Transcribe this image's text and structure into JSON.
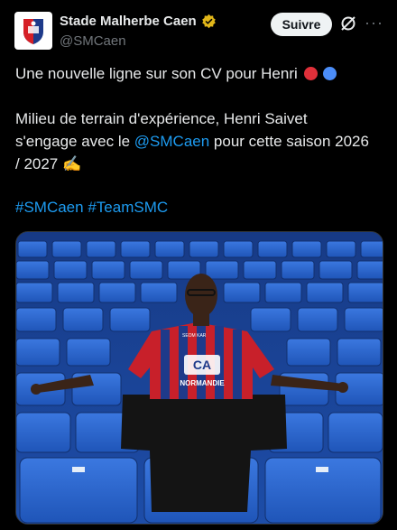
{
  "account": {
    "display_name": "Stade Malherbe Caen",
    "handle": "@SMCaen",
    "verified_badge_color": "#e2b719"
  },
  "actions": {
    "follow_label": "Suivre",
    "grok_icon": "grok-icon",
    "more_icon": "more-icon"
  },
  "tweet": {
    "line1": "Une nouvelle ligne sur son CV pour Henri",
    "line1_emoji": [
      "red-circle",
      "blue-circle"
    ],
    "para2_a": "Milieu de terrain d'expérience, Henri Saivet",
    "para2_b_pre": "s'engage avec le ",
    "para2_b_mention": "@SMCaen",
    "para2_b_post": " pour cette saison 2026",
    "para2_c": "/ 2027 ✍️",
    "hashtag1": "#SMCaen",
    "hashtag2": "#TeamSMC"
  },
  "media": {
    "jersey_sponsor": "CA",
    "jersey_brand": "NORMANDIE",
    "jersey_chest_text": "SEOM KAR"
  },
  "colors": {
    "background": "#000000",
    "text": "#e7e9ea",
    "secondary": "#71767b",
    "link": "#1d9bf0",
    "seat_blue": "#2a63c9"
  }
}
